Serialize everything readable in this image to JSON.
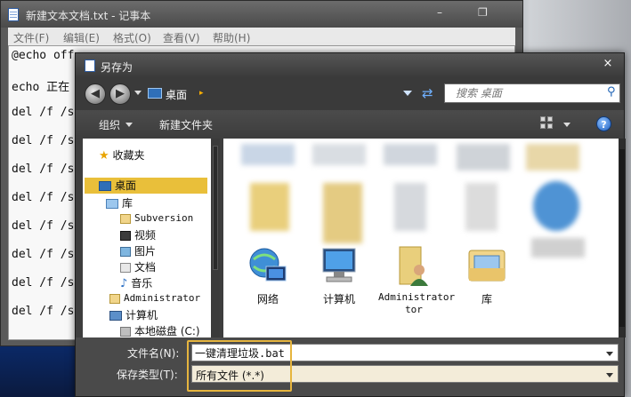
{
  "notepad": {
    "title": "新建文本文档.txt - 记事本",
    "window_controls": {
      "minimize": "–",
      "restore": "❐"
    },
    "menu": [
      "文件(F)",
      "编辑(E)",
      "格式(O)",
      "查看(V)",
      "帮助(H)"
    ],
    "lines": [
      "@echo off",
      "echo 正在",
      "del /f /s",
      "del /f /s",
      "del /f /s",
      "del /f /s",
      "del /f /s",
      "del /f /s",
      "del /f /s",
      "del /f /s"
    ]
  },
  "dialog": {
    "title": "另存为",
    "close_glyph": "×",
    "address": {
      "location": "桌面",
      "separator": "▸"
    },
    "search": {
      "placeholder": "搜索 桌面"
    },
    "toolbar": {
      "organize": "组织",
      "new_folder": "新建文件夹"
    },
    "nav_tree": [
      {
        "label": "收藏夹",
        "icon": "star-icon"
      },
      {
        "label": "桌面",
        "icon": "desktop-icon",
        "selected": true
      },
      {
        "label": "库",
        "icon": "library-icon"
      },
      {
        "label": "Subversion",
        "icon": "folder-icon"
      },
      {
        "label": "视频",
        "icon": "video-icon"
      },
      {
        "label": "图片",
        "icon": "picture-icon"
      },
      {
        "label": "文档",
        "icon": "document-icon"
      },
      {
        "label": "音乐",
        "icon": "music-icon"
      },
      {
        "label": "Administrator",
        "icon": "user-folder-icon"
      },
      {
        "label": "计算机",
        "icon": "computer-icon"
      },
      {
        "label": "本地磁盘 (C:)",
        "icon": "drive-icon"
      }
    ],
    "files": [
      {
        "label": "网络",
        "icon": "network-icon"
      },
      {
        "label": "计算机",
        "icon": "computer-icon"
      },
      {
        "label": "Administrator",
        "icon": "user-folder-icon"
      },
      {
        "label": "库",
        "icon": "library-icon"
      }
    ],
    "filename_label": "文件名(N):",
    "filename_value": "一键清理垃圾.bat",
    "filetype_label": "保存类型(T):",
    "filetype_value": "所有文件 (*.*)"
  }
}
